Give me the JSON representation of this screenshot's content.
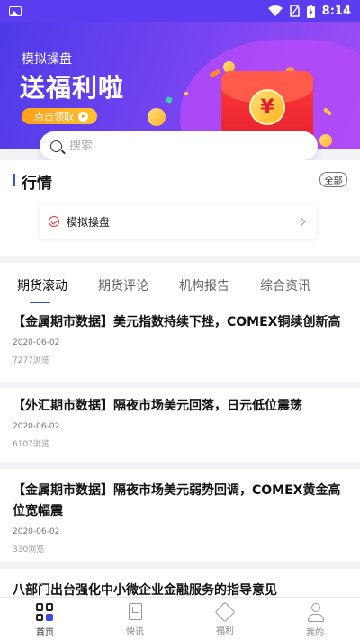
{
  "status_bar": {
    "time": "8:14",
    "icons": [
      "image-icon",
      "wifi-icon",
      "no-sim-icon",
      "battery-charging-icon"
    ]
  },
  "banner": {
    "subtitle": "模拟操盘",
    "title": "送福利啦",
    "button_label": "点击领取",
    "currency_symbol": "¥"
  },
  "search": {
    "placeholder": "搜索"
  },
  "market": {
    "title": "行情",
    "all_label": "全部",
    "card_label": "模拟操盘"
  },
  "tabs": [
    {
      "label": "期货滚动",
      "active": true
    },
    {
      "label": "期货评论",
      "active": false
    },
    {
      "label": "机构报告",
      "active": false
    },
    {
      "label": "综合资讯",
      "active": false
    }
  ],
  "news": [
    {
      "title": "【金属期市数据】美元指数持续下挫，COMEX铜续创新高",
      "date": "2020-06-02",
      "views": "7277浏览"
    },
    {
      "title": "【外汇期市数据】隔夜市场美元回落，日元低位震荡",
      "date": "2020-06-02",
      "views": "6107浏览"
    },
    {
      "title": "【金属期市数据】隔夜市场美元弱势回调，COMEX黄金高位宽幅震",
      "date": "2020-06-02",
      "views": "330浏览"
    },
    {
      "title": "八部门出台强化中小微企业金融服务的指导意见"
    }
  ],
  "bottom_nav": [
    {
      "label": "首页",
      "icon": "home-grid-icon",
      "active": true
    },
    {
      "label": "快讯",
      "icon": "news-flash-icon",
      "active": false
    },
    {
      "label": "福利",
      "icon": "gift-icon",
      "active": false
    },
    {
      "label": "我的",
      "icon": "profile-icon",
      "active": false
    }
  ],
  "colors": {
    "primary": "#3b4be0",
    "banner_start": "#4d3ae8",
    "banner_end": "#a24ff5",
    "button": "#ffb21a",
    "envelope": "#e21e2c"
  }
}
